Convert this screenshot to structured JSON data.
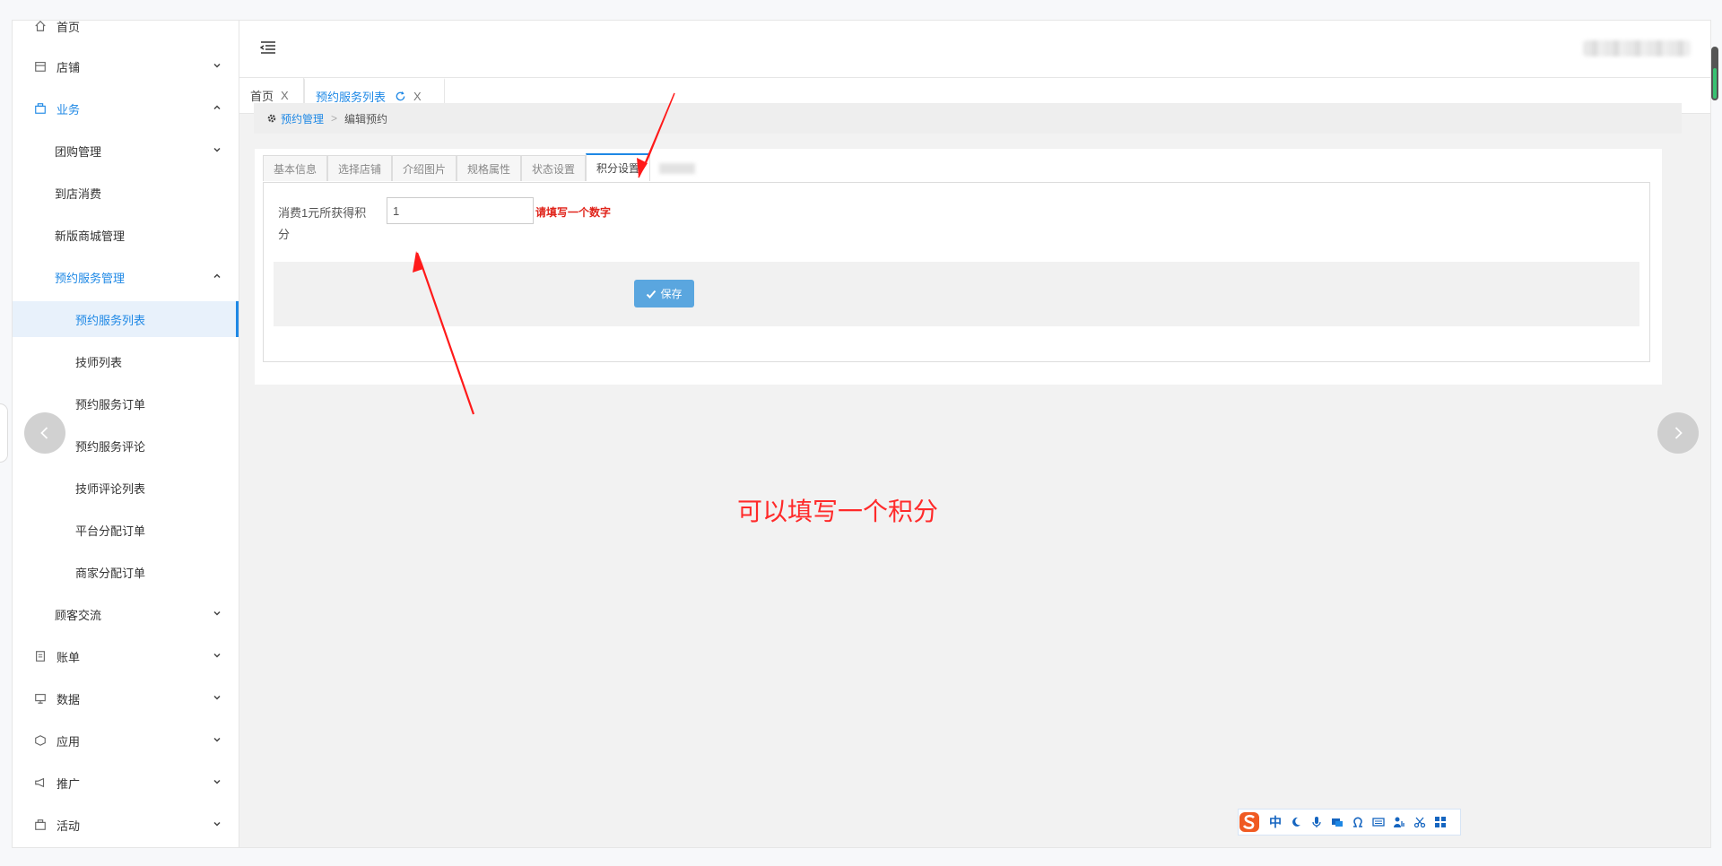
{
  "sidebar": {
    "items": [
      {
        "label": "首页",
        "icon": "home-icon"
      },
      {
        "label": "店铺",
        "icon": "store-icon"
      },
      {
        "label": "业务",
        "icon": "business-icon"
      },
      {
        "label": "团购管理"
      },
      {
        "label": "到店消费"
      },
      {
        "label": "新版商城管理"
      },
      {
        "label": "预约服务管理"
      },
      {
        "label": "预约服务列表"
      },
      {
        "label": "技师列表"
      },
      {
        "label": "预约服务订单"
      },
      {
        "label": "预约服务评论"
      },
      {
        "label": "技师评论列表"
      },
      {
        "label": "平台分配订单"
      },
      {
        "label": "商家分配订单"
      },
      {
        "label": "顾客交流"
      },
      {
        "label": "账单",
        "icon": "bill-icon"
      },
      {
        "label": "数据",
        "icon": "data-icon"
      },
      {
        "label": "应用",
        "icon": "app-icon"
      },
      {
        "label": "推广",
        "icon": "megaphone-icon"
      },
      {
        "label": "活动",
        "icon": "activity-icon"
      }
    ]
  },
  "page_tabs": [
    {
      "label": "首页",
      "close": "X"
    },
    {
      "label": "预约服务列表",
      "close": "X"
    }
  ],
  "breadcrumb": {
    "parent": "预约管理",
    "separator": ">",
    "current": "编辑预约"
  },
  "form_tabs": [
    "基本信息",
    "选择店铺",
    "介绍图片",
    "规格属性",
    "状态设置",
    "积分设置"
  ],
  "form": {
    "points_label": "消费1元所获得积分",
    "points_value": "1",
    "points_hint": "请填写一个数字",
    "save_label": "保存"
  },
  "annotation": "可以填写一个积分",
  "ime": {
    "mode": "中"
  },
  "colors": {
    "accent": "#1e88e5",
    "hint": "#e0241b",
    "annotation": "#ff2a2a",
    "save_button": "#5aa6df"
  }
}
